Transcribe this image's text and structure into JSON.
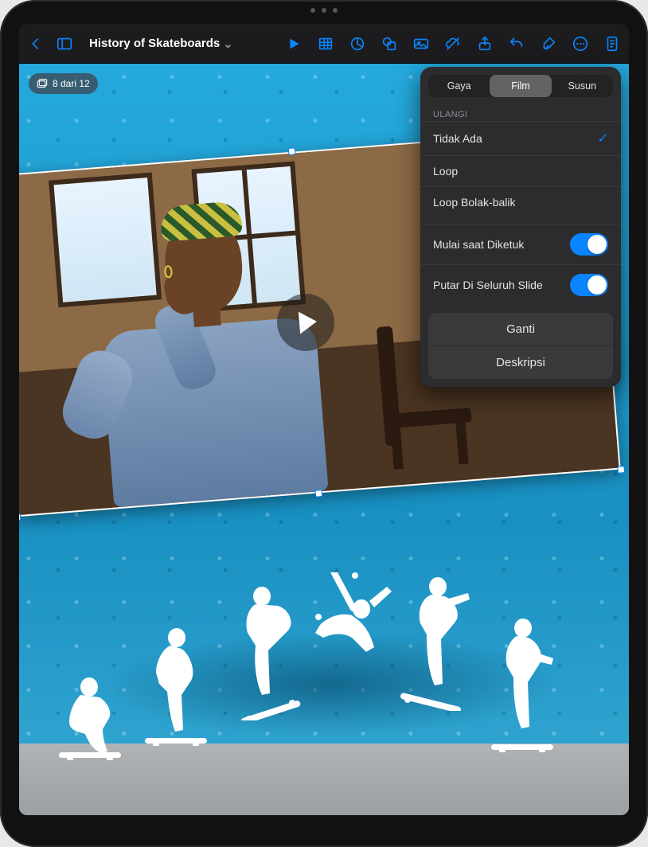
{
  "toolbar": {
    "doc_title": "History of Skateboards"
  },
  "slide_badge": {
    "text": "8 dari 12"
  },
  "popover": {
    "tabs": {
      "style": "Gaya",
      "film": "Film",
      "arrange": "Susun"
    },
    "section_repeat": "ULANGI",
    "repeat_options": {
      "none": "Tidak Ada",
      "loop": "Loop",
      "loop_back": "Loop Bolak-balik"
    },
    "start_on_tap": "Mulai saat Diketuk",
    "play_across_slides": "Putar Di Seluruh Slide",
    "replace": "Ganti",
    "description": "Deskripsi"
  }
}
